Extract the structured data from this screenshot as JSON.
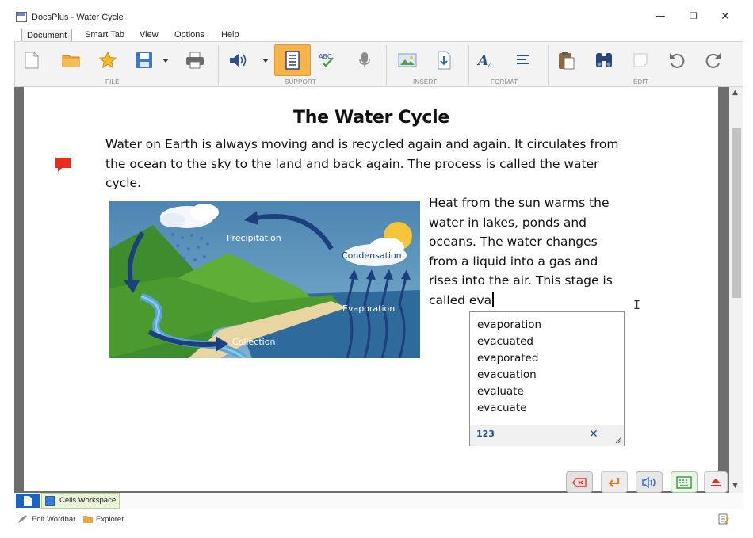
{
  "window": {
    "title": "DocsPlus - Water Cycle",
    "controls": {
      "minimize": "—",
      "maximize": "❐",
      "close": "✕"
    }
  },
  "menu": {
    "tabs": [
      "Document",
      "Smart Tab",
      "View",
      "Options",
      "Help"
    ],
    "active": "Document"
  },
  "ribbon": {
    "groups": [
      "FILE",
      "SUPPORT",
      "INSERT",
      "FORMAT",
      "EDIT"
    ],
    "icons": [
      "new-file-icon",
      "open-folder-icon",
      "favorite-star-icon",
      "save-icon",
      "dropdown-arrow-icon",
      "print-icon",
      "speaker-icon",
      "dropdown-arrow-icon",
      "word-prediction-icon",
      "spell-check-icon",
      "microphone-icon",
      "insert-image-icon",
      "insert-file-icon",
      "font-format-icon",
      "paragraph-align-icon",
      "paste-icon",
      "find-binoculars-icon",
      "comment-note-icon",
      "undo-icon",
      "redo-icon"
    ],
    "spell_check_text": "ABC",
    "colors": {
      "active": "#f6b24b",
      "accent_blue": "#1f4e9c"
    }
  },
  "document": {
    "title": "The Water Cycle",
    "paragraph1": "Water on Earth is always moving and is recycled again and again. It circulates from the ocean to the sky to the land and back again. The process is called the water cycle.",
    "paragraph2_lines": [
      "Heat from the sun warms the",
      "water in lakes, ponds  and",
      "oceans. The water changes",
      "from a liquid into a gas and",
      "rises into the air. This stage is"
    ],
    "typed_prefix": "called eva",
    "figure_labels": {
      "precipitation": "Precipitation",
      "condensation": "Condensation",
      "evaporation": "Evaporation",
      "collection": "Collection"
    }
  },
  "autocomplete": {
    "suggestions": [
      "evaporation",
      "evacuated",
      "evaporated",
      "evacuation",
      "evaluate",
      "evacuate"
    ],
    "footer_number_label": "123",
    "close": "✕"
  },
  "floating_buttons": [
    "backspace-icon",
    "enter-icon",
    "speak-icon",
    "keyboard-icon",
    "eject-icon"
  ],
  "bottom_tabs": {
    "cells_workspace": "Cells Workspace"
  },
  "statusbar": {
    "edit_wordbar": "Edit Wordbar",
    "explorer": "Explorer"
  }
}
